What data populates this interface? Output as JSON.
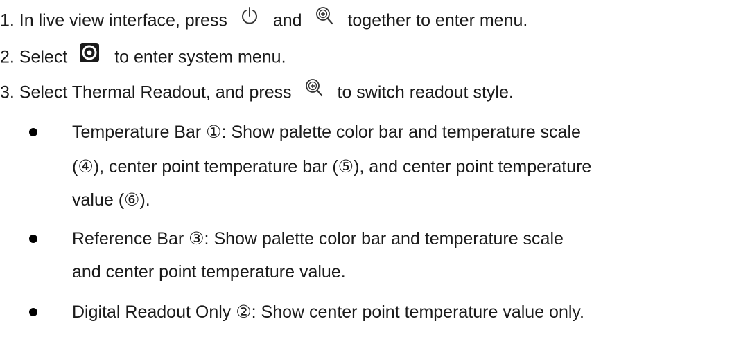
{
  "steps": [
    {
      "prefix": "1. In live view interface, press",
      "mid": "and",
      "suffix": "together to enter menu.",
      "icons": [
        "power-icon",
        "zoom-in-icon"
      ]
    },
    {
      "prefix": "2. Select",
      "suffix": "to enter system menu.",
      "icons": [
        "settings-icon"
      ]
    },
    {
      "prefix": "3. Select Thermal Readout, and press",
      "suffix": "to switch readout style.",
      "icons": [
        "zoom-in-icon"
      ]
    }
  ],
  "bullets": [
    {
      "lines": [
        "Temperature Bar  ①: Show palette color bar and temperature scale",
        "(④), center point temperature bar (⑤), and center point temperature",
        "value (⑥)."
      ]
    },
    {
      "lines": [
        "Reference Bar  ③: Show palette color bar and temperature scale",
        "and center point temperature value."
      ]
    },
    {
      "lines": [
        "Digital Readout Only  ②: Show center point temperature value only."
      ]
    }
  ]
}
